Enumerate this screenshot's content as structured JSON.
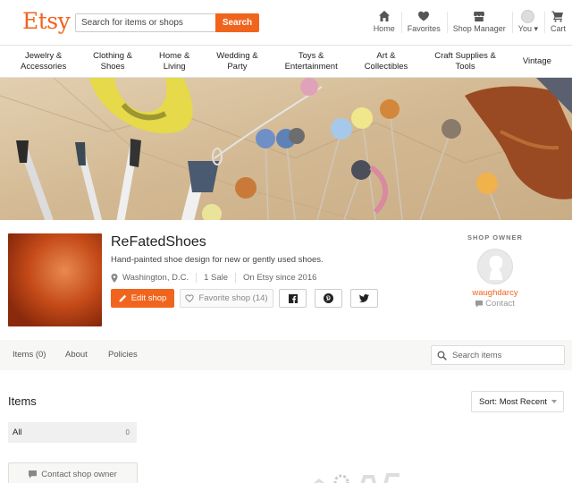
{
  "header": {
    "logo": "Etsy",
    "search_placeholder": "Search for items or shops",
    "search_button": "Search",
    "nav": [
      {
        "label": "Home",
        "icon": "home-icon"
      },
      {
        "label": "Favorites",
        "icon": "heart-icon"
      },
      {
        "label": "Shop Manager",
        "icon": "store-icon"
      },
      {
        "label": "You",
        "icon": "avatar"
      },
      {
        "label": "Cart",
        "icon": "cart-icon"
      }
    ]
  },
  "categories": [
    [
      "Jewelry &",
      "Accessories"
    ],
    [
      "Clothing &",
      "Shoes"
    ],
    [
      "Home &",
      "Living"
    ],
    [
      "Wedding &",
      "Party"
    ],
    [
      "Toys &",
      "Entertainment"
    ],
    [
      "Art &",
      "Collectibles"
    ],
    [
      "Craft Supplies &",
      "Tools"
    ],
    [
      "Vintage",
      ""
    ]
  ],
  "shop": {
    "name": "ReFatedShoes",
    "tagline": "Hand-painted shoe design for new or gently used shoes.",
    "location": "Washington, D.C.",
    "sales": "1 Sale",
    "since": "On Etsy since 2016",
    "edit_label": "Edit shop",
    "favorite_label": "Favorite shop (14)"
  },
  "owner": {
    "label": "SHOP OWNER",
    "name": "waughdarcy",
    "contact": "Contact"
  },
  "tabs": {
    "items": "Items (0)",
    "about": "About",
    "policies": "Policies",
    "search_placeholder": "Search items"
  },
  "items_section": {
    "title": "Items",
    "sort": "Sort: Most Recent",
    "filter_all": "All",
    "filter_all_count": "0",
    "contact_owner": "Contact shop owner"
  },
  "colors": {
    "brand": "#f1641e",
    "banner_paper": "#d9c3a1"
  }
}
